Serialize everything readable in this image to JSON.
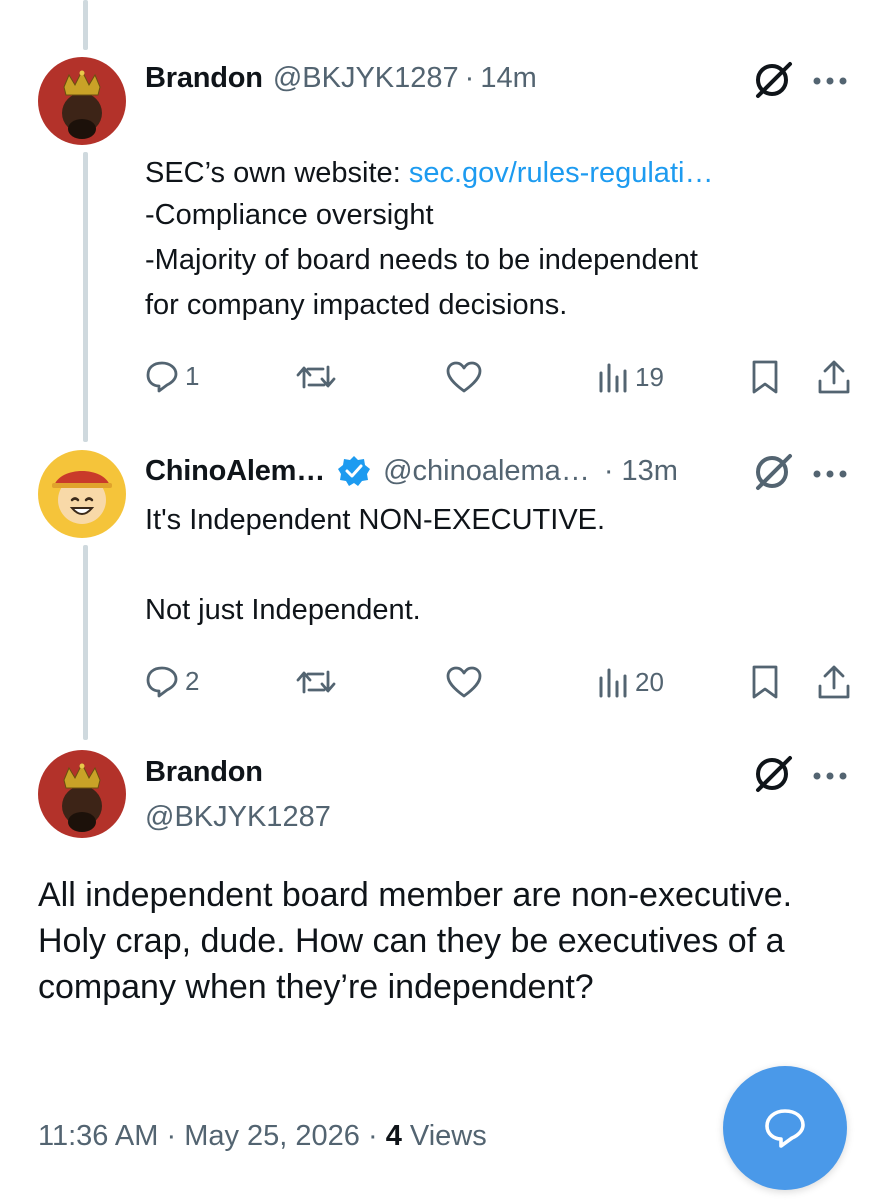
{
  "tweets": [
    {
      "name": "Brandon",
      "handle": "@BKJYK1287",
      "time": "14m",
      "sep": "·",
      "text_prefix": "SEC’s own website: ",
      "link": "sec.gov/rules-regulati…",
      "text_body": "-Compliance oversight\n-Majority of board needs to be independent\nfor company impacted decisions.",
      "replies": "1",
      "views": "19"
    },
    {
      "name": "ChinoAlem…",
      "handle": "@chinoalema…",
      "time": "13m",
      "sep": "·",
      "text": "It's Independent NON-EXECUTIVE.\n\nNot just Independent.",
      "replies": "2",
      "views": "20"
    }
  ],
  "main_tweet": {
    "name": "Brandon",
    "handle": "@BKJYK1287",
    "text": "All independent board member are non-executive. Holy crap, dude. How can they be executives of a company when they’re independent?",
    "time": "11:36 AM",
    "date": "May 25, 2026",
    "sep": "·",
    "views_count": "4",
    "views_label": "Views"
  },
  "icons": [
    "grok-icon",
    "more-icon",
    "reply-icon",
    "retweet-icon",
    "like-icon",
    "views-icon",
    "bookmark-icon",
    "share-icon",
    "verified-badge-icon",
    "compose-reply-icon"
  ],
  "colors": {
    "link": "#1d9bf0",
    "muted": "#536471",
    "verified": "#1d9bf0",
    "fab": "#4a99e9",
    "thread_line": "#cfd9de"
  }
}
